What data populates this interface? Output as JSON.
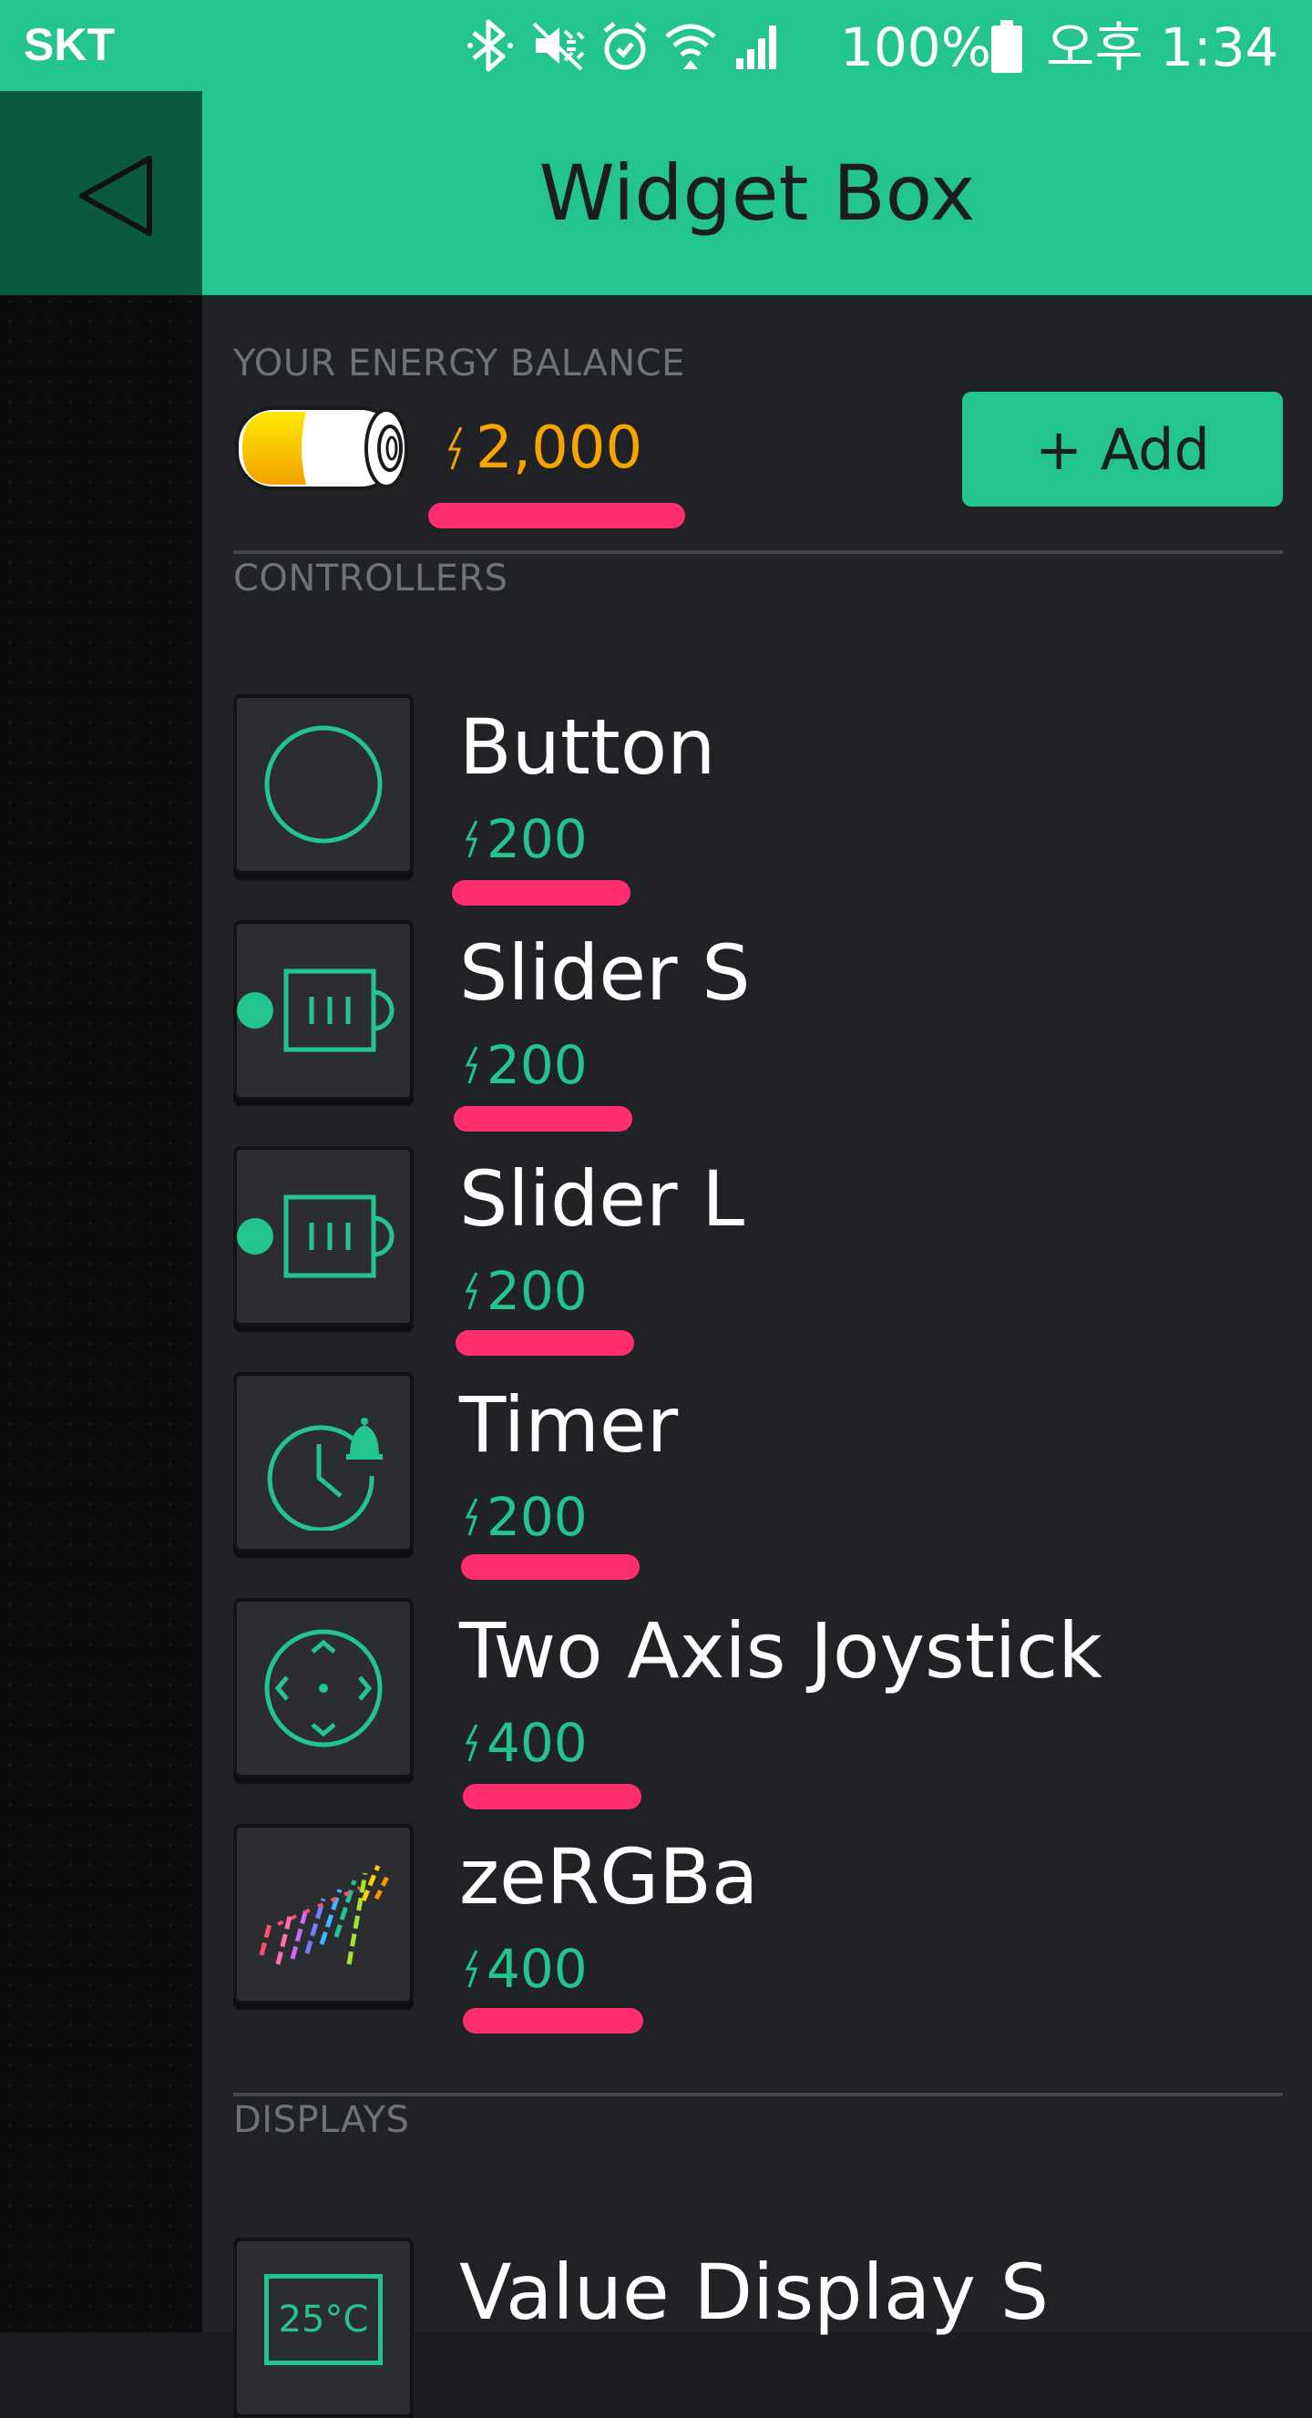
{
  "status_bar": {
    "carrier": "SKT",
    "battery_percent": "100%",
    "time": "오후 1:34",
    "icons": [
      "bluetooth-icon",
      "vibrate-icon",
      "alarm-icon",
      "wifi-icon",
      "signal-icon",
      "battery-icon"
    ]
  },
  "header": {
    "title": "Widget Box",
    "back_icon": "back-triangle-icon"
  },
  "energy": {
    "section_label": "YOUR ENERGY BALANCE",
    "amount": "2,000",
    "add_label": "+ Add",
    "battery_level": 0.4
  },
  "controllers": {
    "section_label": "CONTROLLERS",
    "items": [
      {
        "name": "Button",
        "cost": "200",
        "icon": "button-circle-icon"
      },
      {
        "name": "Slider S",
        "cost": "200",
        "icon": "slider-icon"
      },
      {
        "name": "Slider L",
        "cost": "200",
        "icon": "slider-icon"
      },
      {
        "name": "Timer",
        "cost": "200",
        "icon": "timer-icon"
      },
      {
        "name": "Two Axis Joystick",
        "cost": "400",
        "icon": "joystick-icon"
      },
      {
        "name": "zeRGBa",
        "cost": "400",
        "icon": "zebra-icon"
      }
    ]
  },
  "displays": {
    "section_label": "DISPLAYS",
    "items": [
      {
        "name": "Value Display S",
        "icon_text": "25°C",
        "icon": "value-display-icon"
      }
    ]
  },
  "colors": {
    "brand_green": "#23c48e",
    "energy_orange": "#f6a400",
    "underline_pink": "#ff2e6e",
    "panel_bg": "#212226"
  }
}
